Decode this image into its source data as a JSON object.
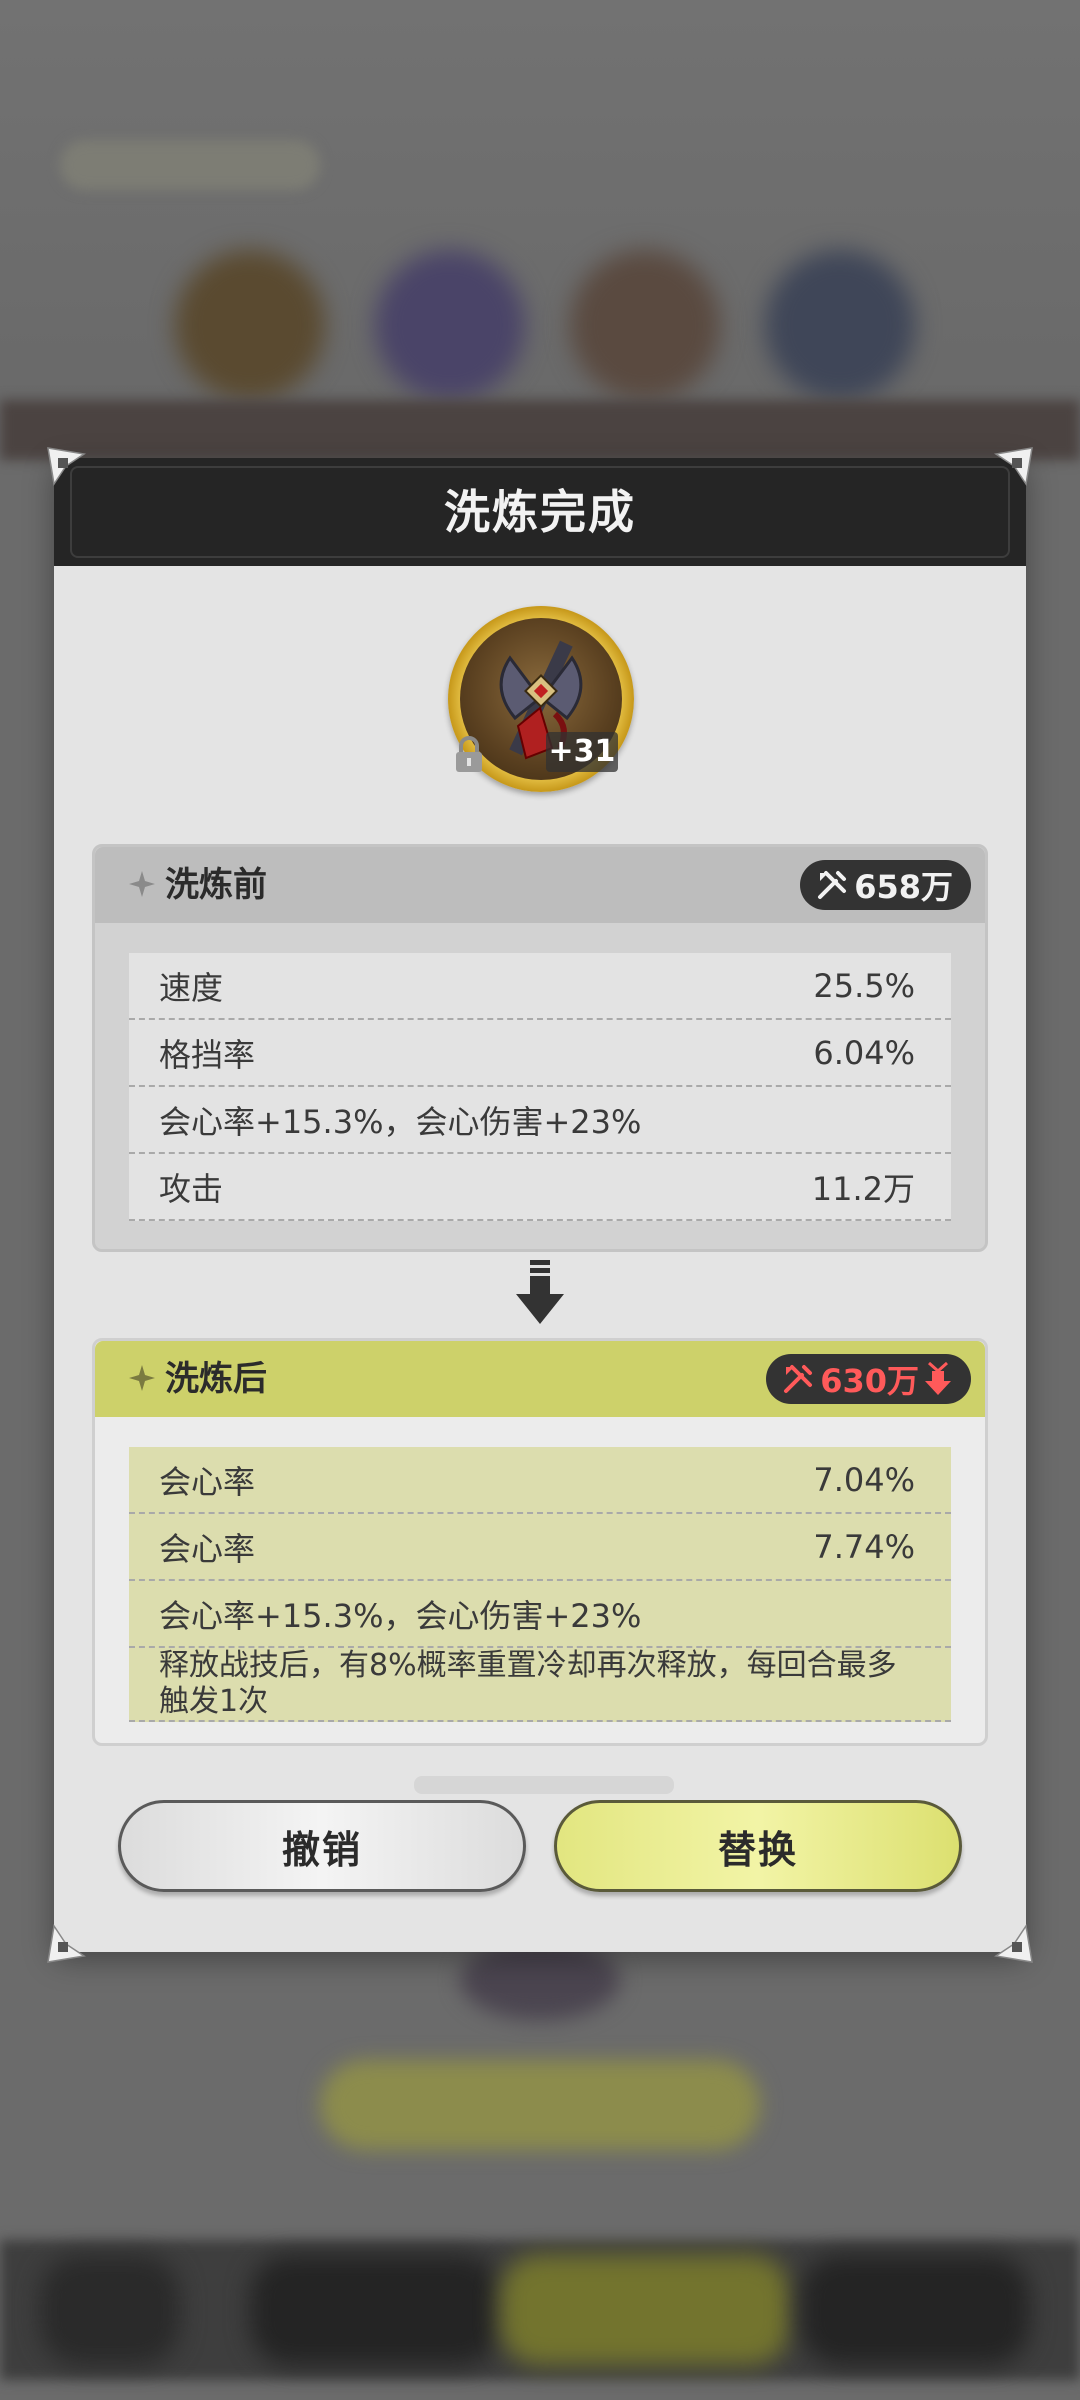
{
  "dialog": {
    "title": "洗炼完成"
  },
  "item": {
    "level": "+31",
    "icon": "axe-weapon-icon",
    "locked": true
  },
  "before": {
    "title": "洗炼前",
    "power": "658万",
    "stats": [
      {
        "name": "速度",
        "value": "25.5%"
      },
      {
        "name": "格挡率",
        "value": "6.04%"
      },
      {
        "name": "会心率+15.3%，会心伤害+23%",
        "value": ""
      },
      {
        "name": "攻击",
        "value": "11.2万"
      }
    ]
  },
  "after": {
    "title": "洗炼后",
    "power": "630万",
    "power_trend": "down",
    "stats": [
      {
        "name": "会心率",
        "value": "7.04%"
      },
      {
        "name": "会心率",
        "value": "7.74%"
      },
      {
        "name": "会心率+15.3%，会心伤害+23%",
        "value": ""
      },
      {
        "name": "释放战技后，有8%概率重置冷却再次释放，每回合最多触发1次",
        "value": ""
      }
    ]
  },
  "buttons": {
    "cancel": "撤销",
    "replace": "替换"
  },
  "colors": {
    "header_bg": "#252525",
    "after_accent": "#cdd16a",
    "power_down": "#ff5a5a"
  }
}
